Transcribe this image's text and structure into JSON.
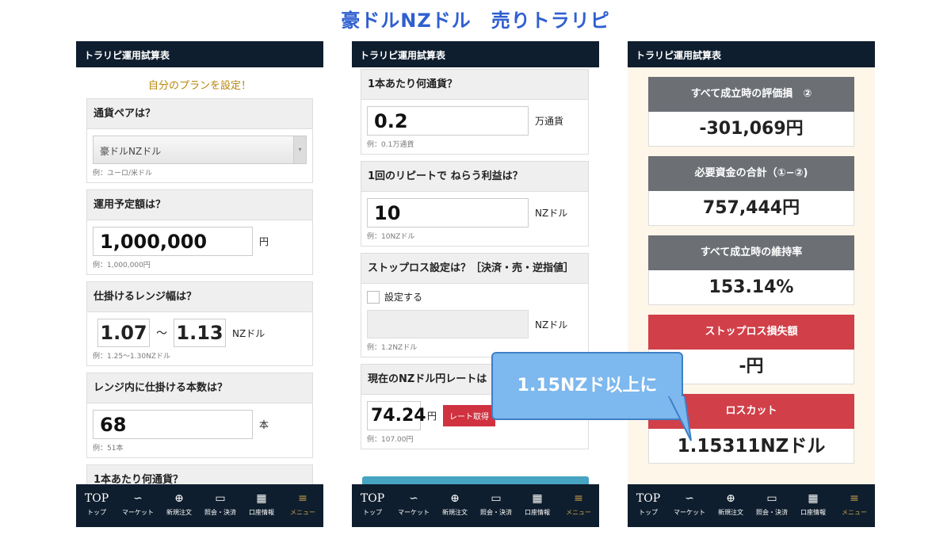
{
  "title": "豪ドルNZドル　売りトラリピ",
  "app_header": "トラリピ運用試算表",
  "phone1": {
    "plan_heading": "自分のプランを設定！",
    "pair_q": "通貨ペアは？",
    "pair_value": "豪ドルNZドル",
    "pair_eg": "例：ユーロ/米ドル",
    "amount_q": "運用予定額は？",
    "amount_value": "1,000,000",
    "amount_unit": "円",
    "amount_eg": "例：1,000,000円",
    "range_q": "仕掛けるレンジ幅は？",
    "range_low": "1.07",
    "range_sep": "〜",
    "range_high": "1.13",
    "range_unit": "NZドル",
    "range_eg": "例：1.25〜1.30NZドル",
    "count_q": "レンジ内に仕掛ける本数は？",
    "count_value": "68",
    "count_unit": "本",
    "count_eg": "例：51本",
    "next_q": "1本あたり何通貨？"
  },
  "phone2": {
    "units_q": "1本あたり何通貨？",
    "units_value": "0.2",
    "units_unit": "万通貨",
    "units_eg": "例：0.1万通貨",
    "profit_q": "1回のリピートで ねらう利益は？",
    "profit_value": "10",
    "profit_unit": "NZドル",
    "profit_eg": "例：10NZドル",
    "sl_q": "ストップロス設定は？［決済・売・逆指値］",
    "sl_check": "設定する",
    "sl_unit": "NZドル",
    "sl_eg": "例：1.2NZドル",
    "rate_q": "現在のNZドル円レートは",
    "rate_value": "74.24",
    "rate_unit": "円",
    "rate_button": "レート取得",
    "rate_eg": "例：107.00円"
  },
  "phone3": {
    "results": [
      {
        "label": "すべて成立時の評価損　②",
        "value": "-301,069円",
        "color": "gray"
      },
      {
        "label": "必要資金の合計（①−②)",
        "value": "757,444円",
        "color": "gray"
      },
      {
        "label": "すべて成立時の維持率",
        "value": "153.14%",
        "color": "gray"
      },
      {
        "label": "ストップロス損失額",
        "value": "-円",
        "color": "red"
      },
      {
        "label": "ロスカット",
        "value": "1.15311NZドル",
        "color": "red"
      }
    ]
  },
  "callout": "1.15NZド以上に",
  "tabs": [
    {
      "icon": "TOP",
      "label": "トップ"
    },
    {
      "icon": "∽",
      "label": "マーケット"
    },
    {
      "icon": "⊕",
      "label": "新規注文"
    },
    {
      "icon": "▭",
      "label": "照会・決済"
    },
    {
      "icon": "▦",
      "label": "口座情報"
    },
    {
      "icon": "≡",
      "label": "メニュー"
    }
  ],
  "colors": {
    "title_blue": "#2f5fd0",
    "header_navy": "#0f1e2e",
    "red": "#d13f48",
    "gray": "#6c7075",
    "gold": "#c8a24a",
    "callout": "#7db8ee"
  }
}
